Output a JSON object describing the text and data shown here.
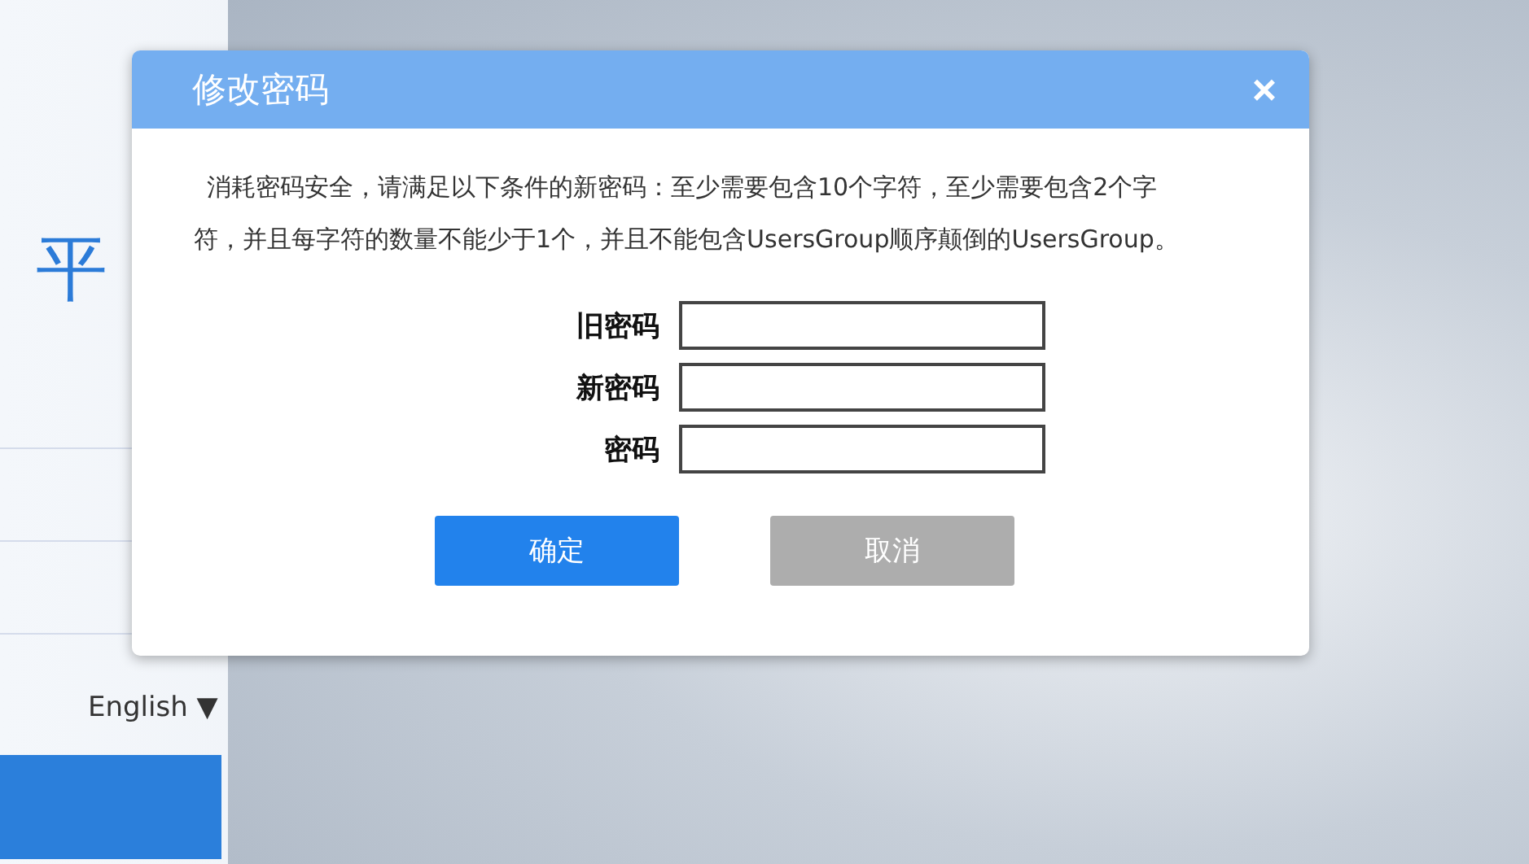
{
  "background": {
    "title": "平",
    "language": "English ▼"
  },
  "dialog": {
    "title": "修改密码",
    "close": "×",
    "message": "消耗密码安全，请满足以下条件的新密码：至少需要包含10个字符，至少需要包含2个字符，并且每字符的数量不能少于1个，并且不能包含UsersGroup顺序颠倒的UsersGroup。",
    "fields": [
      {
        "label": "旧密码"
      },
      {
        "label": "新密码"
      },
      {
        "label": "密码"
      }
    ],
    "buttons": [
      {
        "label": "确定",
        "kind": "primary"
      },
      {
        "label": "取消",
        "kind": "secondary"
      }
    ]
  }
}
